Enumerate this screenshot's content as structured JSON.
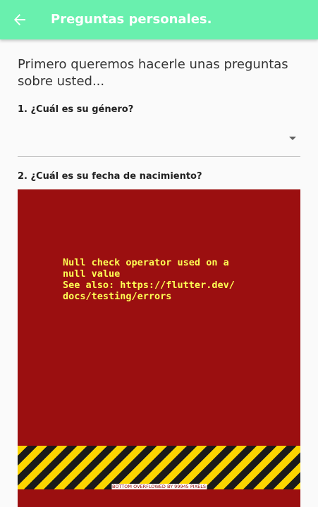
{
  "appbar": {
    "title": "Preguntas personales.",
    "back_icon": "arrow-left-icon",
    "background": "#69f0ae"
  },
  "intro": "Primero queremos hacerle unas preguntas sobre usted...",
  "questions": [
    {
      "label": "1. ¿Cuál es su género?",
      "value": ""
    },
    {
      "label": "2. ¿Cuál es su fecha de nacimiento?"
    }
  ],
  "error": {
    "message": "Null check operator used on a\nnull value\nSee also: https://flutter.dev/\ndocs/testing/errors",
    "overflow_label": "BOTTOM OVERFLOWED BY 99945 PIXELS",
    "background": "#9b0f10",
    "text_color": "#ffff54"
  }
}
